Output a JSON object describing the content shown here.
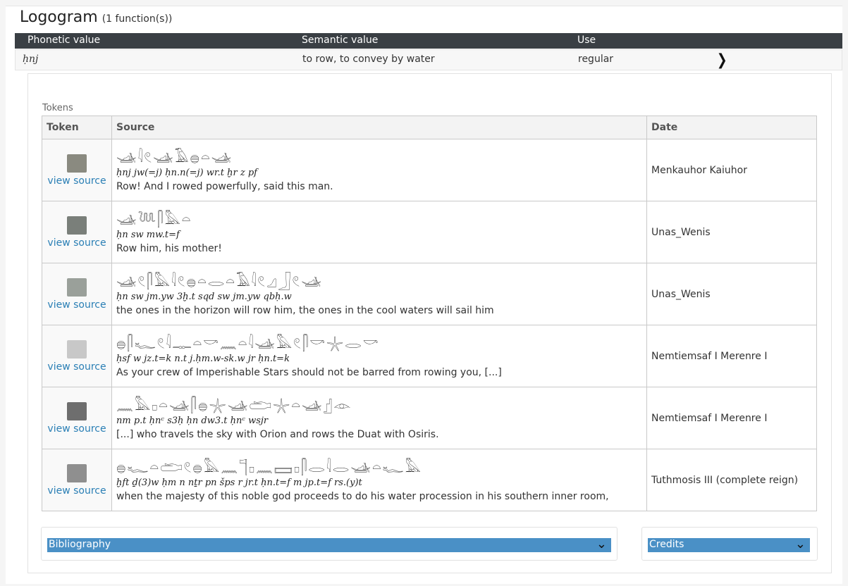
{
  "heading": {
    "title": "Logogram",
    "count": "(1 function(s))"
  },
  "functions_table": {
    "headers": [
      "Phonetic value",
      "Semantic value",
      "Use"
    ],
    "row": {
      "phonetic": "ḥnj",
      "semantic": "to row, to convey by water",
      "use": "regular",
      "chevron_icon": "chevron-right-icon"
    }
  },
  "tokens_section": {
    "label": "Tokens",
    "headers": {
      "token": "Token",
      "source": "Source",
      "date": "Date"
    },
    "rows": [
      {
        "thumb_color": "#8a8a80",
        "link": "view source",
        "glyphs": "𓊛𓇋𓏲𓊛𓄿𓐍𓏏𓊛",
        "translit": "ḥnj jw(=j) ḥn.n(=j) wr.t ḫr z pf",
        "translation": "Row! And I rowed powerfully, said this man.",
        "date": "Menkauhor Kaiuhor"
      },
      {
        "thumb_color": "#7a7f7a",
        "link": "view source",
        "glyphs": "𓊛𓆙𓋴𓅓𓏏",
        "translit": "ḥn sw mw.t=f",
        "translation": "Row him, his mother!",
        "date": "Unas_Wenis"
      },
      {
        "thumb_color": "#9aa09a",
        "link": "view source",
        "glyphs": "𓊛𓏲𓋴𓅓𓇋𓏲𓐍𓏏𓂋𓏏𓄿𓇋𓏲𓈎𓃀𓏲𓊛",
        "translit": "ḥn sw jm.yw 3ḫ.t sqd sw jm.yw qbḥ.w",
        "translation": "the ones in the horizon will row him, the ones in the cool waters will sail him",
        "date": "Unas_Wenis"
      },
      {
        "thumb_color": "#c8c8c8",
        "link": "view source",
        "glyphs": "𓐍𓋴𓆑𓏲𓇋𓊃𓏏𓎡𓈖𓏏𓇋𓊛𓅓𓏲𓋴𓎡𓇼𓂋𓎡",
        "translit": "ḥsf w jz.t=k n.t j.ḥm.w-sk.w jr ḥn.t=k",
        "translation": "As your crew of Imperishable Stars should not be barred from rowing you, [...]",
        "date": "Nemtiemsaf I Merenre I"
      },
      {
        "thumb_color": "#6e6e6e",
        "link": "view source",
        "glyphs": "𓈖𓅓𓊪𓏏𓊛𓋴𓐍𓇼𓊛𓂧𓇼𓏏𓊛𓊨𓁹",
        "translit": "nm p.t ḥnᶜ s3ḥ ḥn dw3.t ḥnᶜ wsjr",
        "translation": "[...] who travels the sky with Orion and rows the Duat with Osiris.",
        "date": "Nemtiemsaf I Merenre I"
      },
      {
        "thumb_color": "#8f8f8f",
        "link": "view source",
        "glyphs": "𓐍𓆑𓏏𓂧𓏲𓐍𓅓𓈖𓊹𓊪𓈖𓈙𓊪𓋴𓂋𓇋𓂋𓊛𓏏𓆑𓅓",
        "translit": "ḫft ḏ(3)w ḥm n nṯr pn šps r jr.t ḥn.t=f m jp.t=f rs.(y)t",
        "translation": "when the majesty of this noble god proceeds to do his water procession in his southern inner room,",
        "date": "Tuthmosis III (complete reign)"
      }
    ]
  },
  "bibliography": {
    "label": "Bibliography",
    "icon": "chevron-down-icon"
  },
  "credits": {
    "label": "Credits",
    "icon": "chevron-down-icon"
  },
  "colors": {
    "header_bg": "#3a3f44",
    "accent": "#4a90c6",
    "link": "#2a7fb5"
  }
}
